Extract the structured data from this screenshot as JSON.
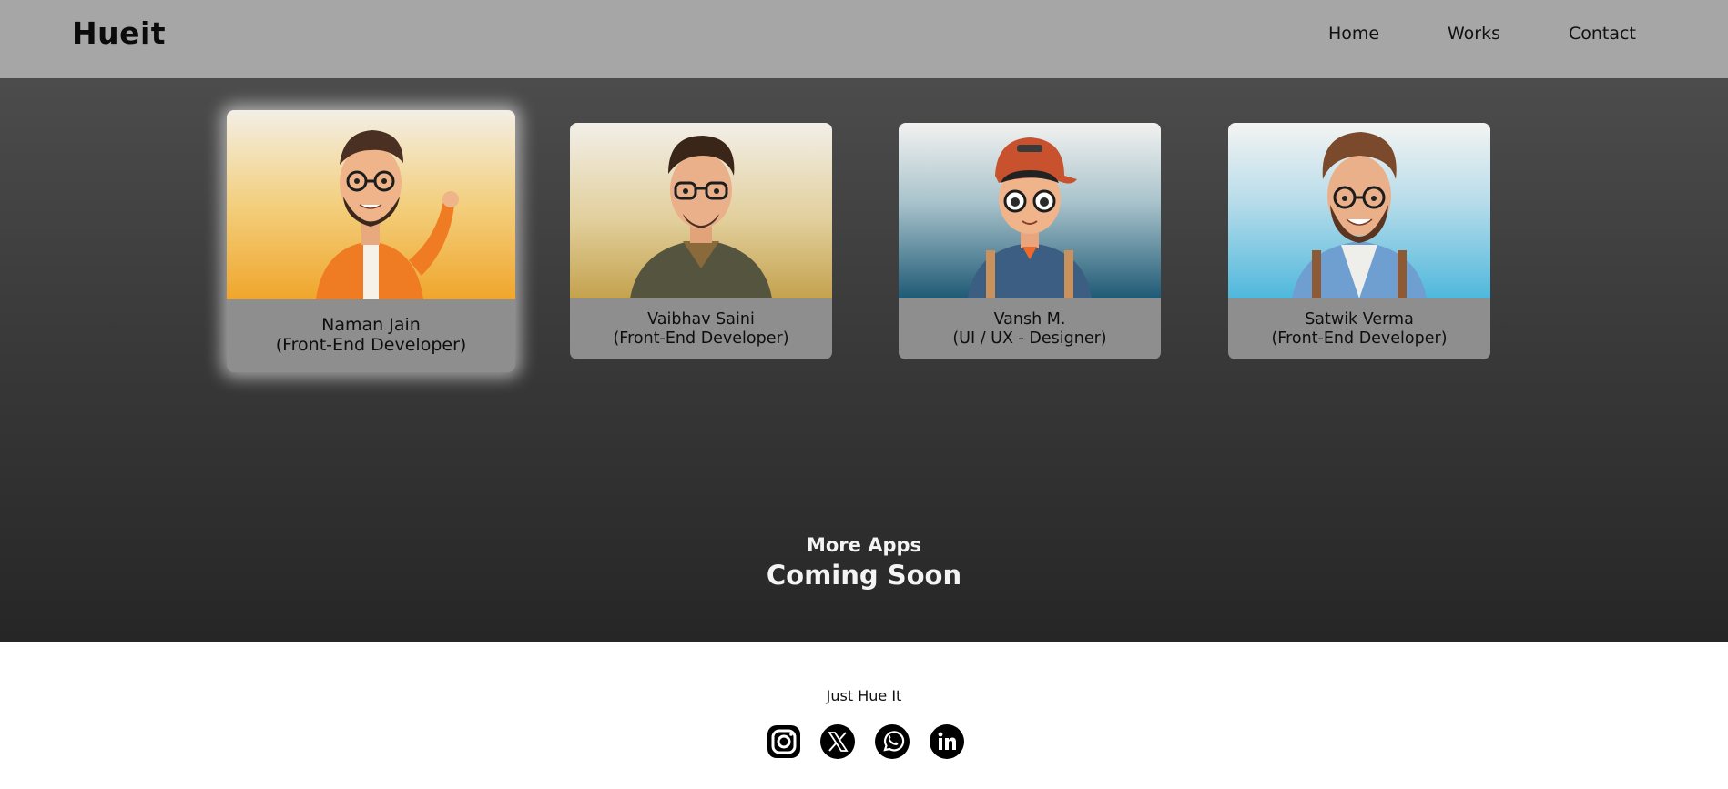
{
  "navbar": {
    "brand": "Hueit",
    "links": [
      {
        "label": "Home"
      },
      {
        "label": "Works"
      },
      {
        "label": "Contact"
      }
    ]
  },
  "team": [
    {
      "name": "Naman Jain",
      "role": "(Front-End Developer)",
      "avatar": "orange-hoodie-avatar"
    },
    {
      "name": "Vaibhav Saini",
      "role": "(Front-End Developer)",
      "avatar": "green-shirt-avatar"
    },
    {
      "name": "Vansh M.",
      "role": "(UI / UX - Designer)",
      "avatar": "cap-boy-avatar"
    },
    {
      "name": "Satwik Verma",
      "role": "(Front-End Developer)",
      "avatar": "blue-shirt-avatar"
    }
  ],
  "coming_soon": {
    "line1": "More Apps",
    "line2": "Coming Soon"
  },
  "footer": {
    "tagline": "Just Hue It",
    "social": [
      "instagram-icon",
      "x-icon",
      "whatsapp-icon",
      "linkedin-icon"
    ]
  },
  "colors": {
    "navbar_bg": "#a6a6a6",
    "card_caption_bg": "#8e8e8e",
    "main_bg_top": "#4c4c4c",
    "main_bg_bottom": "#262626"
  }
}
